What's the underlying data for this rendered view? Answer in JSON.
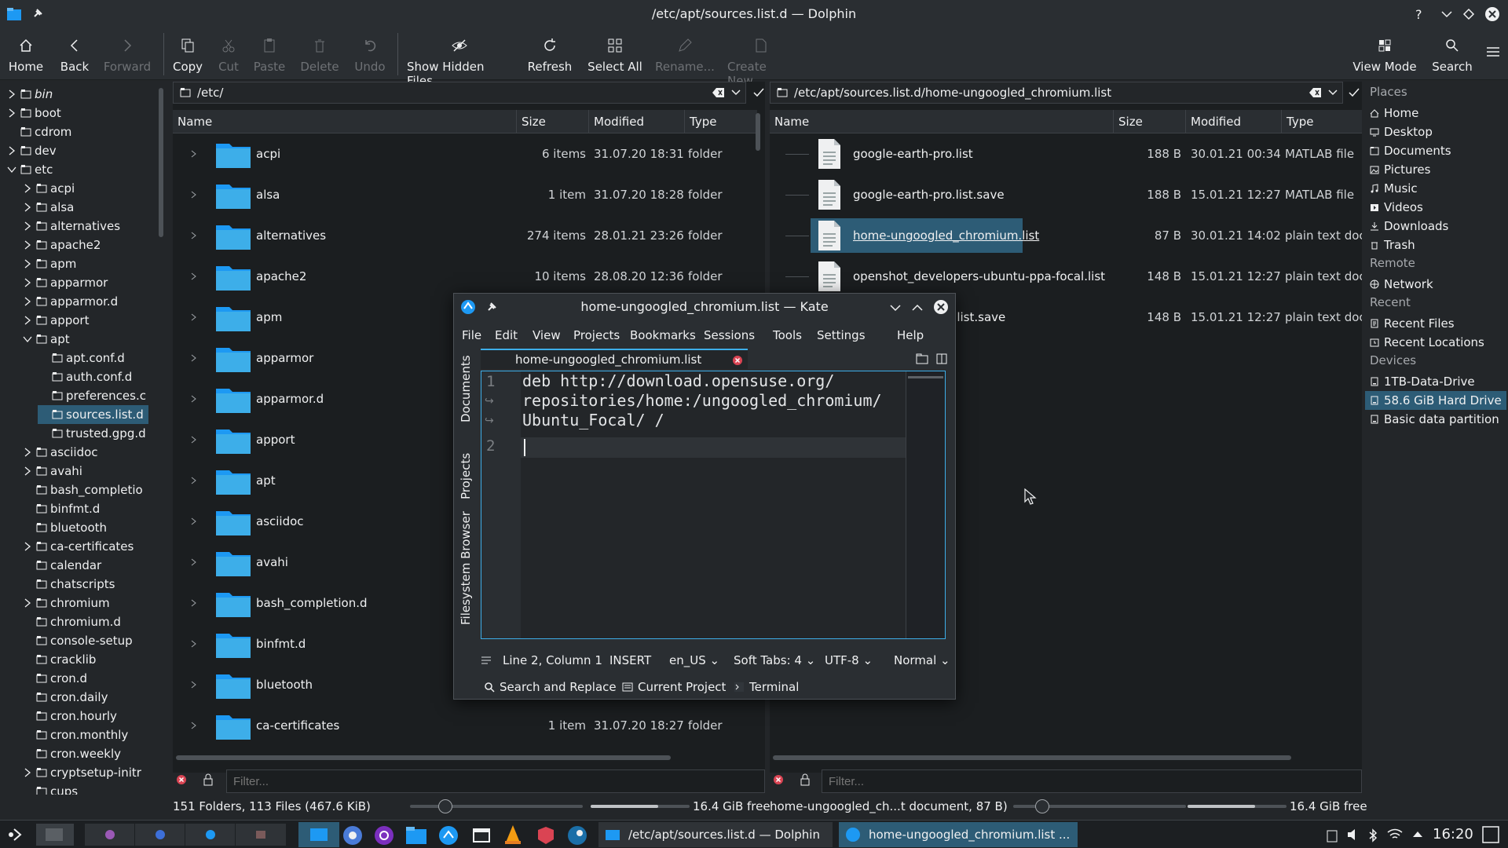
{
  "window": {
    "title": "/etc/apt/sources.list.d — Dolphin"
  },
  "toolbar": {
    "home": "Home",
    "back": "Back",
    "forward": "Forward",
    "copy": "Copy",
    "cut": "Cut",
    "paste": "Paste",
    "delete": "Delete",
    "undo": "Undo",
    "show_hidden": "Show Hidden Files",
    "refresh": "Refresh",
    "select_all": "Select All",
    "rename": "Rename...",
    "create_new": "Create New",
    "view_mode": "View Mode",
    "search": "Search"
  },
  "tree": {
    "items": [
      {
        "label": "bin",
        "indent": 0,
        "expander": "right"
      },
      {
        "label": "boot",
        "indent": 0,
        "expander": "right"
      },
      {
        "label": "cdrom",
        "indent": 0,
        "expander": ""
      },
      {
        "label": "dev",
        "indent": 0,
        "expander": "right"
      },
      {
        "label": "etc",
        "indent": 0,
        "expander": "down"
      },
      {
        "label": "acpi",
        "indent": 1,
        "expander": "right"
      },
      {
        "label": "alsa",
        "indent": 1,
        "expander": "right"
      },
      {
        "label": "alternatives",
        "indent": 1,
        "expander": "right"
      },
      {
        "label": "apache2",
        "indent": 1,
        "expander": "right"
      },
      {
        "label": "apm",
        "indent": 1,
        "expander": "right"
      },
      {
        "label": "apparmor",
        "indent": 1,
        "expander": "right"
      },
      {
        "label": "apparmor.d",
        "indent": 1,
        "expander": "right"
      },
      {
        "label": "apport",
        "indent": 1,
        "expander": "right"
      },
      {
        "label": "apt",
        "indent": 1,
        "expander": "down"
      },
      {
        "label": "apt.conf.d",
        "indent": 2,
        "expander": ""
      },
      {
        "label": "auth.conf.d",
        "indent": 2,
        "expander": ""
      },
      {
        "label": "preferences.c",
        "indent": 2,
        "expander": ""
      },
      {
        "label": "sources.list.d",
        "indent": 2,
        "expander": "",
        "selected": true
      },
      {
        "label": "trusted.gpg.d",
        "indent": 2,
        "expander": ""
      },
      {
        "label": "asciidoc",
        "indent": 1,
        "expander": "right"
      },
      {
        "label": "avahi",
        "indent": 1,
        "expander": "right"
      },
      {
        "label": "bash_completio",
        "indent": 1,
        "expander": ""
      },
      {
        "label": "binfmt.d",
        "indent": 1,
        "expander": ""
      },
      {
        "label": "bluetooth",
        "indent": 1,
        "expander": ""
      },
      {
        "label": "ca-certificates",
        "indent": 1,
        "expander": "right"
      },
      {
        "label": "calendar",
        "indent": 1,
        "expander": ""
      },
      {
        "label": "chatscripts",
        "indent": 1,
        "expander": ""
      },
      {
        "label": "chromium",
        "indent": 1,
        "expander": "right"
      },
      {
        "label": "chromium.d",
        "indent": 1,
        "expander": ""
      },
      {
        "label": "console-setup",
        "indent": 1,
        "expander": ""
      },
      {
        "label": "cracklib",
        "indent": 1,
        "expander": ""
      },
      {
        "label": "cron.d",
        "indent": 1,
        "expander": ""
      },
      {
        "label": "cron.daily",
        "indent": 1,
        "expander": ""
      },
      {
        "label": "cron.hourly",
        "indent": 1,
        "expander": ""
      },
      {
        "label": "cron.monthly",
        "indent": 1,
        "expander": ""
      },
      {
        "label": "cron.weekly",
        "indent": 1,
        "expander": ""
      },
      {
        "label": "cryptsetup-initr",
        "indent": 1,
        "expander": "right"
      },
      {
        "label": "cups",
        "indent": 1,
        "expander": ""
      }
    ]
  },
  "left_pane": {
    "location": "/etc/",
    "headers": {
      "name": "Name",
      "size": "Size",
      "modified": "Modified",
      "type": "Type"
    },
    "rows": [
      {
        "name": "acpi",
        "size": "6 items",
        "modified": "31.07.20 18:31",
        "type": "folder"
      },
      {
        "name": "alsa",
        "size": "1 item",
        "modified": "31.07.20 18:28",
        "type": "folder"
      },
      {
        "name": "alternatives",
        "size": "274 items",
        "modified": "28.01.21 23:26",
        "type": "folder"
      },
      {
        "name": "apache2",
        "size": "10 items",
        "modified": "28.08.20 12:36",
        "type": "folder"
      },
      {
        "name": "apm",
        "size": "",
        "modified": "",
        "type": ""
      },
      {
        "name": "apparmor",
        "size": "",
        "modified": "",
        "type": ""
      },
      {
        "name": "apparmor.d",
        "size": "",
        "modified": "",
        "type": ""
      },
      {
        "name": "apport",
        "size": "",
        "modified": "",
        "type": ""
      },
      {
        "name": "apt",
        "size": "",
        "modified": "",
        "type": ""
      },
      {
        "name": "asciidoc",
        "size": "",
        "modified": "",
        "type": ""
      },
      {
        "name": "avahi",
        "size": "",
        "modified": "",
        "type": ""
      },
      {
        "name": "bash_completion.d",
        "size": "",
        "modified": "",
        "type": ""
      },
      {
        "name": "binfmt.d",
        "size": "",
        "modified": "",
        "type": ""
      },
      {
        "name": "bluetooth",
        "size": "",
        "modified": "",
        "type": ""
      },
      {
        "name": "ca-certificates",
        "size": "1 item",
        "modified": "31.07.20 18:27",
        "type": "folder"
      }
    ],
    "filter_placeholder": "Filter..."
  },
  "right_pane": {
    "location": "/etc/apt/sources.list.d/home-ungoogled_chromium.list",
    "headers": {
      "name": "Name",
      "size": "Size",
      "modified": "Modified",
      "type": "Type"
    },
    "rows": [
      {
        "name": "google-earth-pro.list",
        "size": "188 B",
        "modified": "30.01.21 00:34",
        "type": "MATLAB file"
      },
      {
        "name": "google-earth-pro.list.save",
        "size": "188 B",
        "modified": "15.01.21 12:27",
        "type": "MATLAB file"
      },
      {
        "name": "home-ungoogled_chromium.list",
        "size": "87 B",
        "modified": "30.01.21 14:02",
        "type": "plain text doc"
      },
      {
        "name": "openshot_developers-ubuntu-ppa-focal.list",
        "size": "148 B",
        "modified": "15.01.21 12:27",
        "type": "plain text doc"
      },
      {
        "name": "pers-...-ppa-focal.list.save",
        "size": "148 B",
        "modified": "15.01.21 12:27",
        "type": "plain text doc"
      }
    ],
    "filter_placeholder": "Filter..."
  },
  "places": {
    "places_header": "Places",
    "places": [
      "Home",
      "Desktop",
      "Documents",
      "Pictures",
      "Music",
      "Videos",
      "Downloads",
      "Trash"
    ],
    "remote_header": "Remote",
    "remote": [
      "Network"
    ],
    "recent_header": "Recent",
    "recent": [
      "Recent Files",
      "Recent Locations"
    ],
    "devices_header": "Devices",
    "devices": [
      "1TB-Data-Drive",
      "58.6 GiB Hard Drive",
      "Basic data partition"
    ]
  },
  "status": {
    "left": "151 Folders, 113 Files (467.6 KiB)",
    "left_free": "16.4 GiB free",
    "right": "home-ungoogled_ch...t document, 87 B)",
    "right_free": "16.4 GiB free"
  },
  "kate": {
    "title": "home-ungoogled_chromium.list — Kate",
    "menu": [
      "File",
      "Edit",
      "View",
      "Projects",
      "Bookmarks",
      "Sessions",
      "Tools",
      "Settings",
      "Help"
    ],
    "tab": "home-ungoogled_chromium.list",
    "side_tabs": [
      "Documents",
      "Projects",
      "Filesystem Browser"
    ],
    "lines": [
      "deb http://download.opensuse.org/",
      "repositories/home:/ungoogled_chromium/",
      "Ubuntu_Focal/ /"
    ],
    "line_numbers": [
      "1",
      "2"
    ],
    "status": {
      "position": "Line 2, Column 1",
      "mode": "INSERT",
      "lang": "en_US",
      "tabs": "Soft Tabs: 4",
      "encoding": "UTF-8",
      "input": "Normal"
    },
    "bottom": {
      "search": "Search and Replace",
      "project": "Current Project",
      "terminal": "Terminal"
    }
  },
  "taskbar": {
    "task1": "/etc/apt/sources.list.d — Dolphin",
    "task2": "home-ungoogled_chromium.list ...",
    "clock": "16:20"
  },
  "colors": {
    "accent": "#3daee9",
    "folder": "#1d99f3",
    "selection": "#2d5c76"
  }
}
